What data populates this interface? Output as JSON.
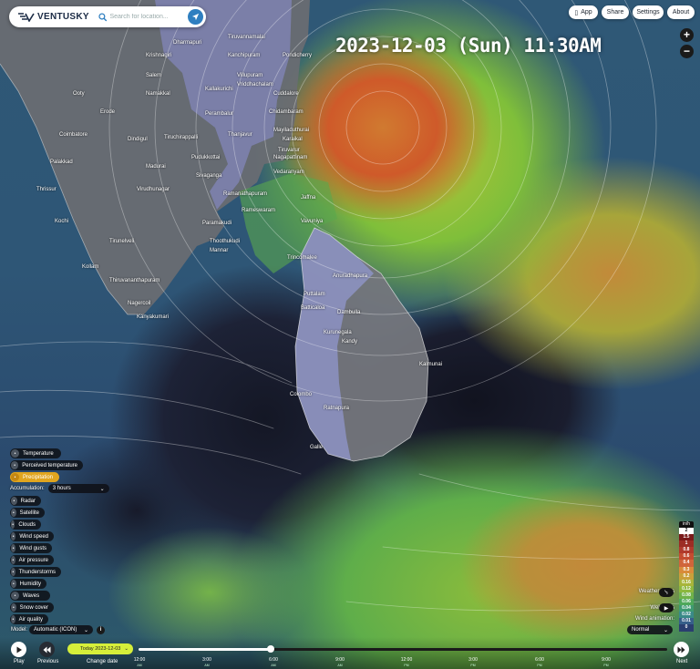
{
  "app": {
    "brand": "VENTUSKY"
  },
  "search": {
    "placeholder": "Search for location..."
  },
  "top_nav": {
    "app": "App",
    "share": "Share",
    "settings": "Settings",
    "about": "About"
  },
  "datetime": "2023-12-03 (Sun) 11:30AM",
  "zoom": {
    "in": "+",
    "out": "−"
  },
  "map_labels": [
    "Dharmapuri",
    "Tiruvannamalai",
    "Kanchipuram",
    "Krishnagiri",
    "Pondicherry",
    "Villupuram",
    "Salem",
    "Kallakurichi",
    "Cuddalore",
    "Vriddhachalam",
    "Namakkal",
    "Chidambaram",
    "Perambalur",
    "Erode",
    "Mayiladuthurai",
    "Karaikal",
    "Tiruchirappalli",
    "Thanjavur",
    "Tiruvarur",
    "Nagapattinam",
    "Dindigul",
    "Pudukkottai",
    "Vedaranyam",
    "Madurai",
    "Sivaganga",
    "Ramanathapuram",
    "Virudhunagar",
    "Rameswaram",
    "Paramakudi",
    "Thoothukudi",
    "Tirunelveli",
    "Mannar",
    "Vavuniya",
    "Trincomalee",
    "Anuradhapura",
    "Puttalam",
    "Batticaloa",
    "Dambulla",
    "Kurunegala",
    "Kandy",
    "Colombo",
    "Ratnapura",
    "Galle",
    "Kalmunai",
    "Jaffna",
    "Ooty",
    "Coimbatore",
    "Palakkad",
    "Thrissur",
    "Kochi",
    "Kollam",
    "Thiruvananthapuram",
    "Nagercoil",
    "Kanyakumari"
  ],
  "layers": {
    "items": [
      {
        "label": "Temperature",
        "icon": "thermometer-icon",
        "active": false
      },
      {
        "label": "Perceived temperature",
        "icon": "perceived-temperature-icon",
        "active": false
      },
      {
        "label": "Precipitation",
        "icon": "raindrop-icon",
        "active": true
      },
      {
        "label": "Radar",
        "icon": "radar-icon",
        "active": false
      },
      {
        "label": "Satellite",
        "icon": "satellite-icon",
        "active": false
      },
      {
        "label": "Clouds",
        "icon": "cloud-icon",
        "active": false
      },
      {
        "label": "Wind speed",
        "icon": "wind-icon",
        "active": false
      },
      {
        "label": "Wind gusts",
        "icon": "wind-gust-icon",
        "active": false
      },
      {
        "label": "Air pressure",
        "icon": "pressure-icon",
        "active": false
      },
      {
        "label": "Thunderstorms",
        "icon": "lightning-icon",
        "active": false
      },
      {
        "label": "Humidity",
        "icon": "humidity-icon",
        "active": false
      },
      {
        "label": "Waves",
        "icon": "waves-icon",
        "active": false
      },
      {
        "label": "Snow cover",
        "icon": "snowflake-icon",
        "active": false
      },
      {
        "label": "Air quality",
        "icon": "air-quality-icon",
        "active": false
      }
    ],
    "accumulation_label": "Accumulation:",
    "accumulation_value": "3 hours"
  },
  "model": {
    "label": "Model:",
    "value": "Automatic (ICON)",
    "info": "i"
  },
  "legend": {
    "unit": "in/h",
    "values": [
      "2",
      "1.5",
      "1",
      "0.8",
      "0.6",
      "0.4",
      "0.3",
      "0.2",
      "0.16",
      "0.12",
      "0.08",
      "0.06",
      "0.04",
      "0.02",
      "0.01",
      "0"
    ],
    "colors": [
      "#ffffff",
      "#7a1a1a",
      "#9c2d24",
      "#b03a2c",
      "#c44c30",
      "#d0653a",
      "#d98b3a",
      "#c9a03a",
      "#a8b53a",
      "#8db83e",
      "#6fb24a",
      "#4ea85a",
      "#3e9a72",
      "#3a8a88",
      "#375f8a",
      "#2a3e70"
    ]
  },
  "right_controls": {
    "fronts": "Weather fronts",
    "webcams": "Webcams",
    "wind_animation": "Wind animation:",
    "wind_speed": "Normal"
  },
  "timeline": {
    "play": "Play",
    "previous": "Previous",
    "change_date": "Change date",
    "date_value": "Today 2023-12-03",
    "next": "Next",
    "progress": 0.25,
    "ticks": [
      {
        "time": "12:00",
        "ampm": "AM"
      },
      {
        "time": "3:00",
        "ampm": "AM"
      },
      {
        "time": "6:00",
        "ampm": "AM"
      },
      {
        "time": "9:00",
        "ampm": "AM"
      },
      {
        "time": "12:00",
        "ampm": "PM"
      },
      {
        "time": "3:00",
        "ampm": "PM"
      },
      {
        "time": "6:00",
        "ampm": "PM"
      },
      {
        "time": "9:00",
        "ampm": "PM"
      }
    ]
  }
}
